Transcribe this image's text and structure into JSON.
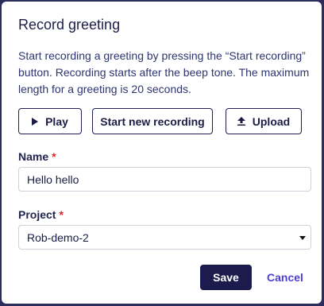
{
  "dialog": {
    "title": "Record greeting",
    "description": "Start recording a greeting by pressing the “Start recording” button. Recording starts after the beep tone. The maximum length for a greeting is 20 seconds."
  },
  "actions": {
    "play_label": "Play",
    "play_icon": "play-icon",
    "new_recording_label": "Start new recording",
    "upload_label": "Upload",
    "upload_icon": "upload-icon"
  },
  "form": {
    "name": {
      "label": "Name",
      "required_mark": "*",
      "value": "Hello hello"
    },
    "project": {
      "label": "Project",
      "required_mark": "*",
      "selected": "Rob-demo-2"
    }
  },
  "footer": {
    "save_label": "Save",
    "cancel_label": "Cancel"
  },
  "colors": {
    "primary": "#1c1b4d",
    "link": "#4d3fd6",
    "required": "#e0262f",
    "backdrop": "#2b2d5c"
  }
}
